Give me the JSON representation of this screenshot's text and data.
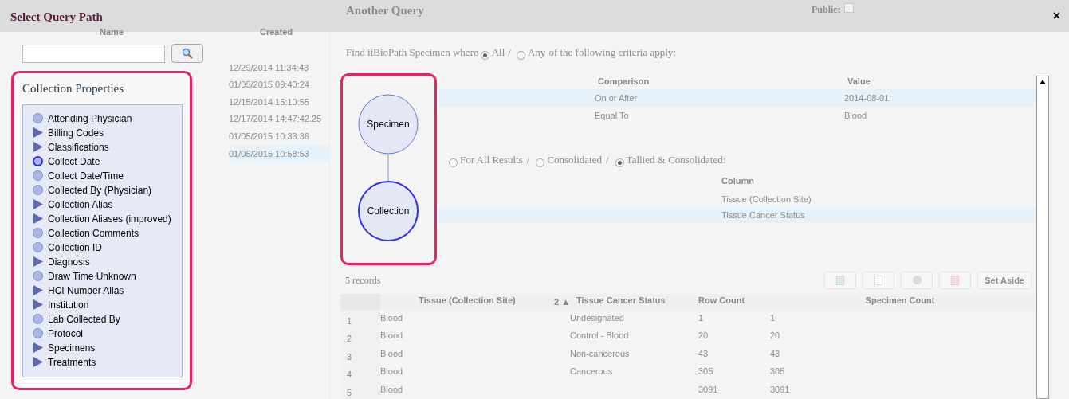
{
  "dialog": {
    "title": "Select Query Path",
    "close": "×"
  },
  "background_header": {
    "query_name": "Another Query",
    "public_label": "Public:",
    "public_checked": false
  },
  "saved_queries": {
    "columns": [
      "Name",
      "Created"
    ],
    "rows": [
      {
        "created": "12/29/2014 11:34:43",
        "selected": false
      },
      {
        "created": "01/05/2015 09:40:24",
        "selected": false
      },
      {
        "created": "12/15/2014 15:10:55",
        "selected": false
      },
      {
        "created": "12/17/2014 14:47:42.25",
        "selected": false
      },
      {
        "created": "01/05/2015 10:33:36",
        "selected": false
      },
      {
        "created": "01/05/2015 10:58:53",
        "selected": true
      }
    ]
  },
  "properties": {
    "title": "Collection Properties",
    "items": [
      {
        "label": "Attending Physician",
        "kind": "leaf",
        "selected": false
      },
      {
        "label": "Billing Codes",
        "kind": "branch",
        "selected": false
      },
      {
        "label": "Classifications",
        "kind": "branch",
        "selected": false
      },
      {
        "label": "Collect Date",
        "kind": "leaf",
        "selected": true
      },
      {
        "label": "Collect Date/Time",
        "kind": "leaf",
        "selected": false
      },
      {
        "label": "Collected By (Physician)",
        "kind": "leaf",
        "selected": false
      },
      {
        "label": "Collection Alias",
        "kind": "branch",
        "selected": false
      },
      {
        "label": "Collection Aliases (improved)",
        "kind": "branch",
        "selected": false
      },
      {
        "label": "Collection Comments",
        "kind": "leaf",
        "selected": false
      },
      {
        "label": "Collection ID",
        "kind": "leaf",
        "selected": false
      },
      {
        "label": "Diagnosis",
        "kind": "branch",
        "selected": false
      },
      {
        "label": "Draw Time Unknown",
        "kind": "leaf",
        "selected": false
      },
      {
        "label": "HCI Number Alias",
        "kind": "branch",
        "selected": false
      },
      {
        "label": "Institution",
        "kind": "branch",
        "selected": false
      },
      {
        "label": "Lab Collected By",
        "kind": "leaf",
        "selected": false
      },
      {
        "label": "Protocol",
        "kind": "leaf",
        "selected": false
      },
      {
        "label": "Specimens",
        "kind": "branch",
        "selected": false
      },
      {
        "label": "Treatments",
        "kind": "branch",
        "selected": false
      }
    ]
  },
  "path_diagram": {
    "nodes": [
      {
        "label": "Specimen",
        "selected": false
      },
      {
        "label": "Collection",
        "selected": true
      }
    ]
  },
  "criteria": {
    "prefix": "Find itBioPath Specimen where",
    "options": [
      {
        "label": "All",
        "selected": true
      },
      {
        "label": "Any",
        "selected": false
      }
    ],
    "separator": "/",
    "suffix": "of the following criteria apply:",
    "columns": [
      "Comparison",
      "Value"
    ],
    "rows": [
      {
        "comparison": "On or After",
        "value": "2014-08-01",
        "selected": true
      },
      {
        "comparison": "Equal To",
        "value": "Blood",
        "selected": false
      }
    ]
  },
  "display": {
    "options": [
      {
        "label": "For All Results",
        "selected": false
      },
      {
        "label": "Consolidated",
        "selected": false
      },
      {
        "label": "Tallied & Consolidated:",
        "selected": true
      }
    ],
    "separator": "/",
    "column_header": "Column",
    "rows": [
      {
        "column": "Tissue (Collection Site)",
        "selected": false
      },
      {
        "column": "Tissue Cancer Status",
        "selected": true
      }
    ]
  },
  "results": {
    "count": "5 records",
    "set_aside": "Set Aside",
    "columns": [
      "Tissue (Collection Site)",
      "2 ▲",
      "Tissue Cancer Status",
      "Row Count",
      "Specimen Count"
    ],
    "rows": [
      {
        "index": "1",
        "tissue": "Blood",
        "status": "Undesignated",
        "row_count": "1",
        "specimen_count": "1"
      },
      {
        "index": "2",
        "tissue": "Blood",
        "status": "Control - Blood",
        "row_count": "20",
        "specimen_count": "20"
      },
      {
        "index": "3",
        "tissue": "Blood",
        "status": "Non-cancerous",
        "row_count": "43",
        "specimen_count": "43"
      },
      {
        "index": "4",
        "tissue": "Blood",
        "status": "Cancerous",
        "row_count": "305",
        "specimen_count": "305"
      },
      {
        "index": "5",
        "tissue": "Blood",
        "status": "",
        "row_count": "3091",
        "specimen_count": "3091"
      }
    ]
  }
}
